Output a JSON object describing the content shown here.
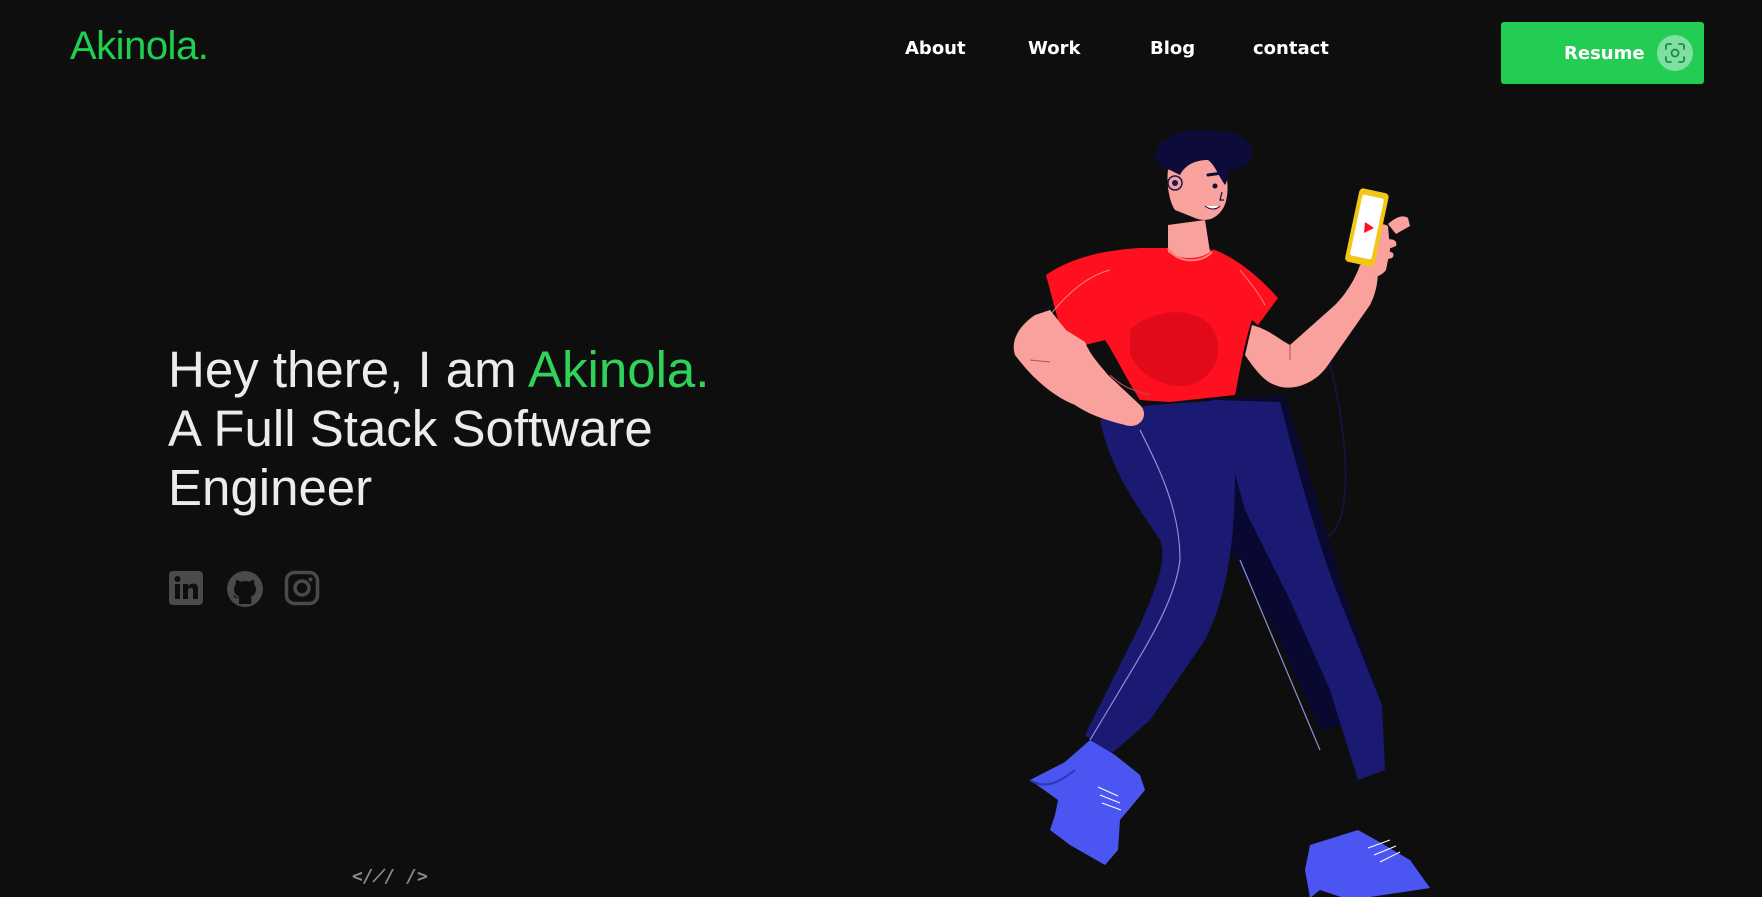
{
  "brand": {
    "logo_text": "Akinola.",
    "accent_color": "#23cc52"
  },
  "nav": {
    "items": [
      {
        "label": "About"
      },
      {
        "label": "Work"
      },
      {
        "label": "Blog"
      },
      {
        "label": "contact"
      }
    ]
  },
  "resume": {
    "label": "Resume",
    "icon": "scan-icon"
  },
  "hero": {
    "greeting": "Hey there, I am ",
    "name": "Akinola.",
    "line2": "A Full Stack Software",
    "line3": "Engineer"
  },
  "socials": [
    {
      "name": "linkedin",
      "icon": "linkedin-icon"
    },
    {
      "name": "github",
      "icon": "github-icon"
    },
    {
      "name": "instagram",
      "icon": "instagram-icon"
    }
  ],
  "footer_mark": "</̸/ />",
  "illustration": {
    "subject": "man walking with phone and earphones"
  }
}
